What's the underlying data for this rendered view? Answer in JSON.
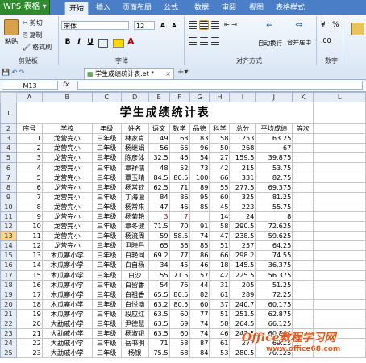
{
  "app": {
    "name": "WPS 表格"
  },
  "menu_tabs": [
    "开始",
    "插入",
    "页面布局",
    "公式",
    "数据",
    "审阅",
    "视图",
    "表格样式"
  ],
  "ribbon": {
    "paste": "粘贴",
    "cut": "剪切",
    "copy": "复制",
    "format_painter": "格式刷",
    "font_name": "宋体",
    "font_size": "12",
    "bold": "B",
    "italic": "I",
    "underline": "U",
    "wrap_text": "自动换行",
    "merge_center": "合并居中",
    "percent": "%",
    "group_clipboard": "剪贴板",
    "group_font": "字体",
    "group_align": "对齐方式",
    "group_number": "数字"
  },
  "doc_tab": {
    "name": "学生成绩统计表.et *"
  },
  "formula_bar": {
    "cell_ref": "M13",
    "fx": "fx",
    "value": ""
  },
  "sheet": {
    "columns": [
      "A",
      "B",
      "C",
      "D",
      "E",
      "F",
      "G",
      "H",
      "I",
      "J",
      "K",
      "L"
    ],
    "title": "学生成绩统计表",
    "header": [
      "序号",
      "学校",
      "年级",
      "姓名",
      "语文",
      "数学",
      "品德",
      "科学",
      "总分",
      "平均成绩",
      "等次"
    ],
    "rows": [
      [
        "1",
        "龙营完小",
        "三年级",
        "林家肖",
        "49",
        "63",
        "83",
        "58",
        "253",
        "63.25",
        ""
      ],
      [
        "2",
        "龙营完小",
        "三年级",
        "杨继娟",
        "56",
        "66",
        "96",
        "50",
        "268",
        "67",
        ""
      ],
      [
        "3",
        "龙营完小",
        "三年级",
        "陈彦体",
        "32.5",
        "46",
        "54",
        "27",
        "159.5",
        "39.875",
        ""
      ],
      [
        "4",
        "龙营完小",
        "三年级",
        "覃祥儒",
        "48",
        "52",
        "73",
        "42",
        "215",
        "53.75",
        ""
      ],
      [
        "5",
        "龙营完小",
        "三年级",
        "覃玉晴",
        "84.5",
        "80.5",
        "100",
        "66",
        "331",
        "82.75",
        ""
      ],
      [
        "6",
        "龙营完小",
        "三年级",
        "杨常钦",
        "62.5",
        "71",
        "89",
        "55",
        "277.5",
        "69.375",
        ""
      ],
      [
        "7",
        "龙营完小",
        "三年级",
        "丁海澶",
        "84",
        "86",
        "95",
        "60",
        "325",
        "81.25",
        ""
      ],
      [
        "8",
        "龙营完小",
        "三年级",
        "杨常来",
        "47",
        "46",
        "85",
        "45",
        "223",
        "55.75",
        ""
      ],
      [
        "9",
        "龙营完小",
        "三年级",
        "杨菊艳",
        "3",
        "7",
        "",
        "14",
        "24",
        "8",
        ""
      ],
      [
        "10",
        "龙营完小",
        "三年级",
        "覃冬健",
        "71.5",
        "70",
        "91",
        "58",
        "290.5",
        "72.625",
        ""
      ],
      [
        "11",
        "龙营完小",
        "三年级",
        "杨流周",
        "59",
        "58.5",
        "74",
        "47",
        "238.5",
        "59.625",
        ""
      ],
      [
        "12",
        "龙营完小",
        "三年级",
        "尹晓丹",
        "65",
        "56",
        "85",
        "51",
        "257",
        "64.25",
        ""
      ],
      [
        "13",
        "木瓜寨小学",
        "三年级",
        "白艳同",
        "69.2",
        "77",
        "86",
        "66",
        "298.2",
        "74.55",
        ""
      ],
      [
        "14",
        "木瓜寨小学",
        "三年级",
        "白自杨",
        "34",
        "45",
        "46",
        "18",
        "145.5",
        "36.375",
        ""
      ],
      [
        "15",
        "木瓜寨小学",
        "三年级",
        "白沙",
        "55",
        "71.5",
        "57",
        "42",
        "225.5",
        "56.375",
        ""
      ],
      [
        "16",
        "木瓜寨小学",
        "三年级",
        "白留香",
        "54",
        "76",
        "44",
        "31",
        "205",
        "51.25",
        ""
      ],
      [
        "17",
        "木瓜寨小学",
        "三年级",
        "白祖香",
        "65.5",
        "80.5",
        "82",
        "61",
        "289",
        "72.25",
        ""
      ],
      [
        "18",
        "木瓜寨小学",
        "三年级",
        "白悦滴",
        "63.2",
        "80.5",
        "60",
        "37",
        "240.7",
        "60.175",
        ""
      ],
      [
        "19",
        "木瓜寨小学",
        "三年级",
        "段应红",
        "63.5",
        "60",
        "77",
        "51",
        "251.5",
        "62.875",
        ""
      ],
      [
        "20",
        "大勐戚小学",
        "三年级",
        "尹德慧",
        "63.5",
        "69",
        "74",
        "58",
        "264.5",
        "66.125",
        ""
      ],
      [
        "21",
        "大勐戚小学",
        "三年级",
        "杨淑娥",
        "63.5",
        "60",
        "74",
        "46",
        "243.5",
        "60.875",
        ""
      ],
      [
        "22",
        "大勐戚小学",
        "三年级",
        "岳书明",
        "71",
        "58",
        "87",
        "61",
        "277",
        "69.25",
        ""
      ],
      [
        "23",
        "大勐戚小学",
        "三年级",
        "杨银",
        "75.5",
        "68",
        "84",
        "53",
        "280.5",
        "70.125",
        ""
      ]
    ]
  },
  "selected_row": "13",
  "watermark": {
    "line1": "Office教程学习网",
    "line2": "www.office68.com"
  }
}
